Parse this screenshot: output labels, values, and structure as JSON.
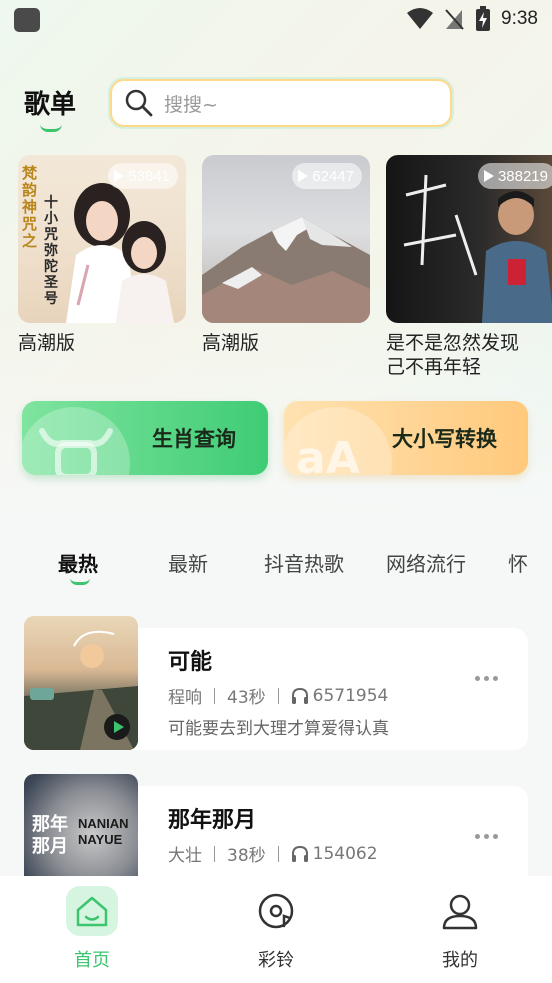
{
  "status_bar": {
    "time": "9:38"
  },
  "header": {
    "title": "歌单",
    "search_placeholder": "搜搜~"
  },
  "playlists": [
    {
      "name": "高潮版",
      "play_count": "53841",
      "cover_text": [
        "梵",
        "韵",
        "神",
        "咒",
        "之"
      ],
      "cover_text_2": [
        "十",
        "小",
        "咒",
        "弥",
        "陀",
        "圣",
        "号"
      ]
    },
    {
      "name": "高潮版",
      "play_count": "62447"
    },
    {
      "name": "是不是忽然发现己不再年轻",
      "play_count": "388219"
    }
  ],
  "features": [
    {
      "label": "生肖查询"
    },
    {
      "label": "大小写转换"
    }
  ],
  "tabs": [
    "最热",
    "最新",
    "抖音热歌",
    "网络流行",
    "怀"
  ],
  "songs": [
    {
      "title": "可能",
      "artist": "程响",
      "duration": "43秒",
      "plays": "6571954",
      "desc": "可能要去到大理才算爱得认真"
    },
    {
      "title": "那年那月",
      "artist": "大壮",
      "duration": "38秒",
      "plays": "154062",
      "desc": "",
      "cover_text": [
        "那年",
        "那月",
        "NANIAN",
        "NAYUE"
      ]
    }
  ],
  "bottom_nav": [
    {
      "label": "首页"
    },
    {
      "label": "彩铃"
    },
    {
      "label": "我的"
    }
  ],
  "colors": {
    "accent": "#3cc46e",
    "search_border": "#ffd98a"
  }
}
